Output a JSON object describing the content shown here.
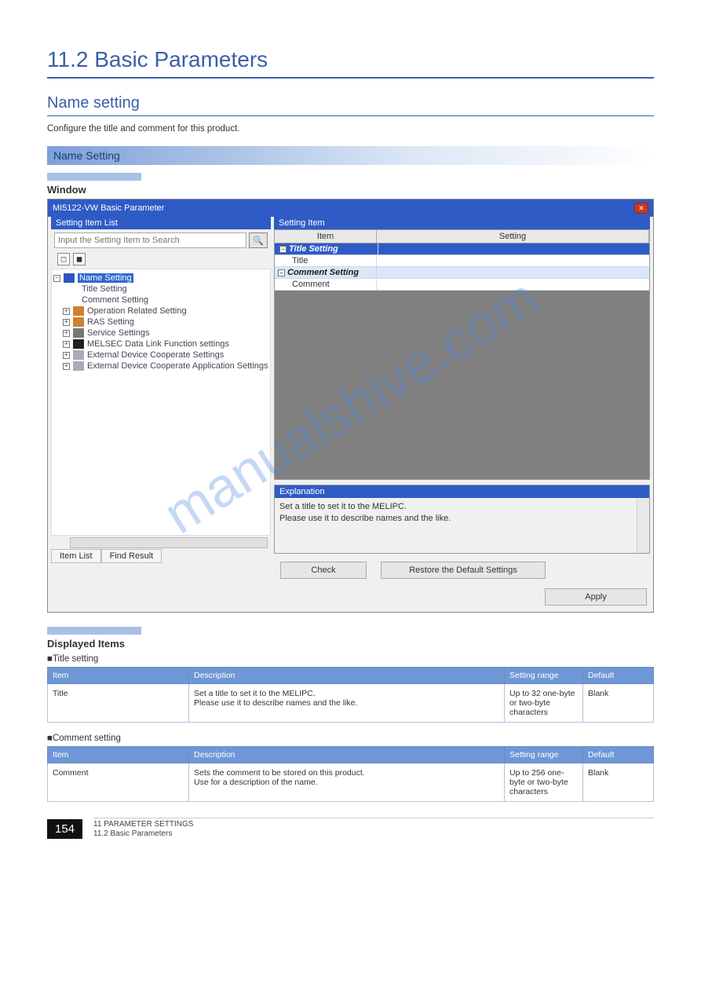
{
  "headings": {
    "h1": "11.2 Basic Parameters",
    "h2": "Name setting",
    "desc": "Configure the title and comment for this product.",
    "navbar": "Name Setting",
    "sub_window": "Window",
    "sub_display": "Displayed Items",
    "sect_title": "■Title setting",
    "sect_comment": "■Comment setting"
  },
  "dialog": {
    "title": "MI5122-VW Basic Parameter",
    "left_header": "Setting Item List",
    "search_placeholder": "Input the Setting Item to Search",
    "tabs": {
      "list": "Item List",
      "find": "Find Result"
    },
    "tree": {
      "root": "Name Setting",
      "c1": "Title Setting",
      "c2": "Comment Setting",
      "n1": "Operation Related Setting",
      "n2": "RAS Setting",
      "n3": "Service Settings",
      "n4": "MELSEC Data Link Function settings",
      "n5": "External Device Cooperate Settings",
      "n6": "External Device Cooperate Application Settings"
    },
    "right_header": "Setting Item",
    "grid": {
      "col_item": "Item",
      "col_setting": "Setting",
      "r1": "Title Setting",
      "r1a": "Title",
      "r2": "Comment Setting",
      "r2a": "Comment"
    },
    "explanation_header": "Explanation",
    "explanation_body1": "Set a title to set it to the MELIPC.",
    "explanation_body2": "Please use it to describe names and the like.",
    "btn_check": "Check",
    "btn_restore": "Restore the Default Settings",
    "btn_apply": "Apply"
  },
  "tbl_title": {
    "head": [
      "Item",
      "Description",
      "Setting range",
      "Default"
    ],
    "row": [
      "Title",
      "Set a title to set it to the MELIPC.\nPlease use it to describe names and the like.",
      "Up to 32 one-byte or two-byte characters",
      "Blank"
    ]
  },
  "tbl_comment": {
    "head": [
      "Item",
      "Description",
      "Setting range",
      "Default"
    ],
    "row": [
      "Comment",
      "Sets the comment to be stored on this product.\nUse for a description of the name.",
      "Up to 256 one-byte or two-byte characters",
      "Blank"
    ]
  },
  "footer": {
    "page": "154",
    "line1": "11 PARAMETER SETTINGS",
    "line2": "11.2 Basic Parameters"
  },
  "watermark": "manualshive.com"
}
